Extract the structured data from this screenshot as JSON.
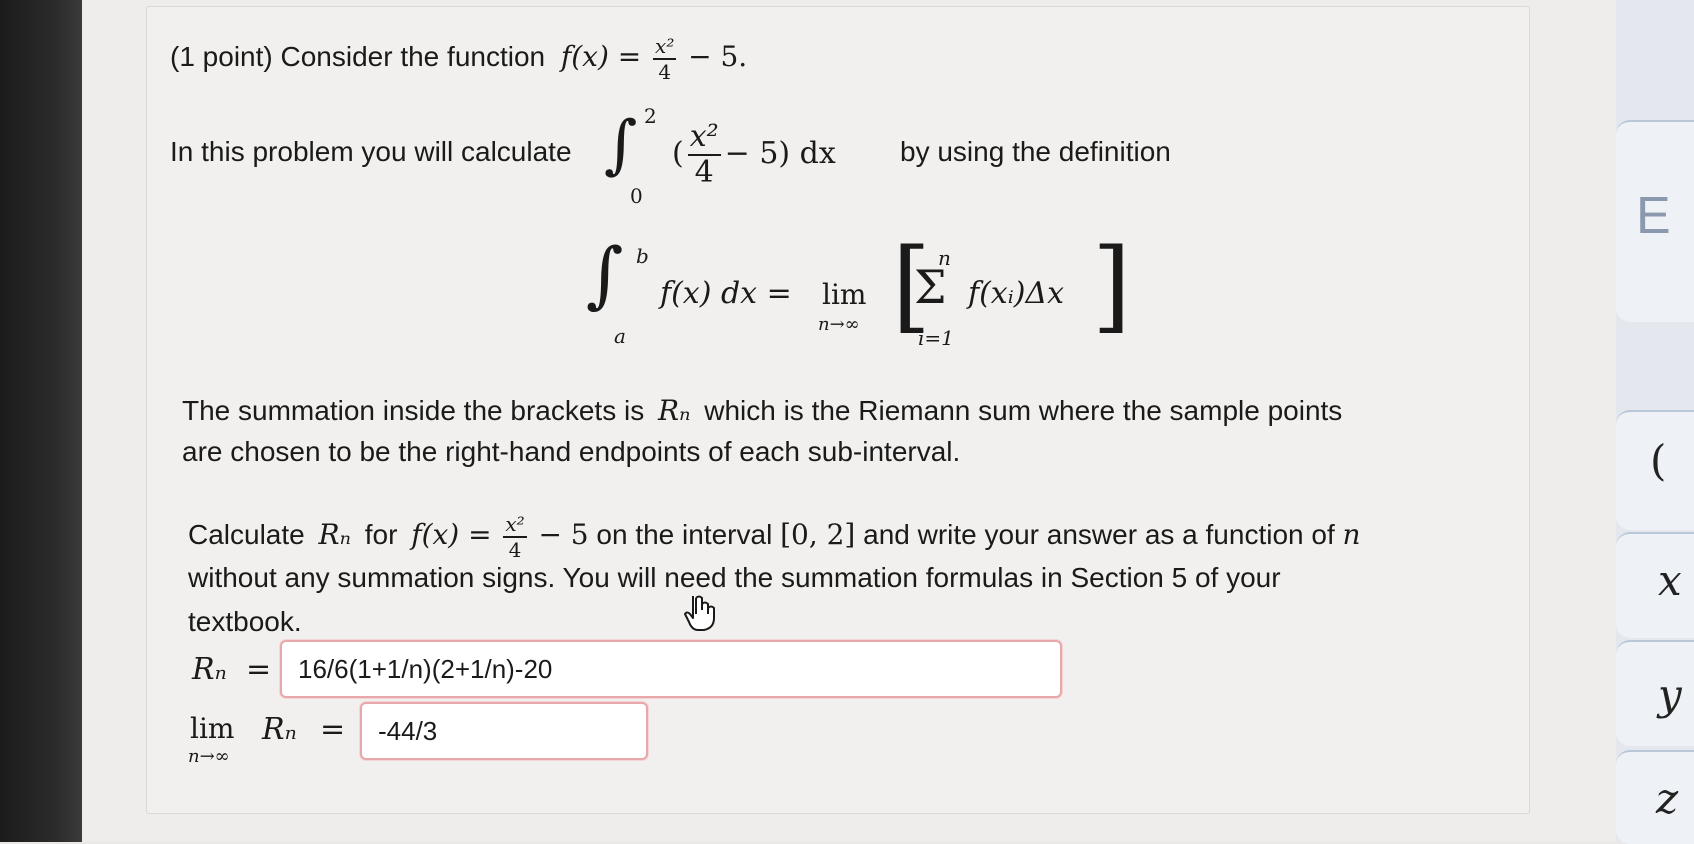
{
  "problem": {
    "header_prefix": "(1 point) Consider the function",
    "header_func": "f(x) =",
    "header_frac_num": "x²",
    "header_frac_den": "4",
    "header_tail": "− 5.",
    "intro_prefix": "In this problem you will calculate",
    "intro_upper": "2",
    "intro_lower": "0",
    "intro_open": "(",
    "intro_frac_num": "x²",
    "intro_frac_den": "4",
    "intro_tail": "− 5) dx",
    "intro_suffix": "by using the definition",
    "def_upper": "b",
    "def_lower": "a",
    "def_integrand": "f(x) dx =",
    "def_lim": "lim",
    "def_lim_sub": "n→∞",
    "def_sum_upper": "n",
    "def_sum_lower": "i=1",
    "def_sum_body": "f(xᵢ)Δx",
    "para1_line1_a": "The summation inside the brackets is",
    "para1_line1_var": "Rₙ",
    "para1_line1_b": "which is the Riemann sum where the sample points",
    "para1_line2": "are chosen to be the right-hand endpoints of each sub-interval.",
    "para2_line1_a": "Calculate",
    "para2_line1_var": "Rₙ",
    "para2_line1_b": "for",
    "para2_line1_func": "f(x) =",
    "para2_frac_num": "x²",
    "para2_frac_den": "4",
    "para2_line1_c": "− 5",
    "para2_line1_d": "on the interval",
    "para2_line1_interval": "[0, 2]",
    "para2_line1_e": "and write your answer as a function of",
    "para2_line1_n": "n",
    "para2_line2": "without any summation signs. You will need the summation formulas in Section 5 of your",
    "para2_line3": "textbook."
  },
  "answers": {
    "rn_label": "Rₙ",
    "rn_eq": "=",
    "rn_value": "16/6(1+1/n)(2+1/n)-20",
    "lim_label": "lim",
    "lim_sub": "n→∞",
    "lim_var": "Rₙ",
    "lim_eq": "=",
    "lim_value": "-44/3"
  },
  "side_panel": {
    "glyphs": [
      "E",
      "(",
      "x",
      "y",
      "z"
    ]
  },
  "colors": {
    "answer_border": "#e8a8ab",
    "text": "#1a1a1a",
    "panel_accent": "#b9c7d8"
  }
}
